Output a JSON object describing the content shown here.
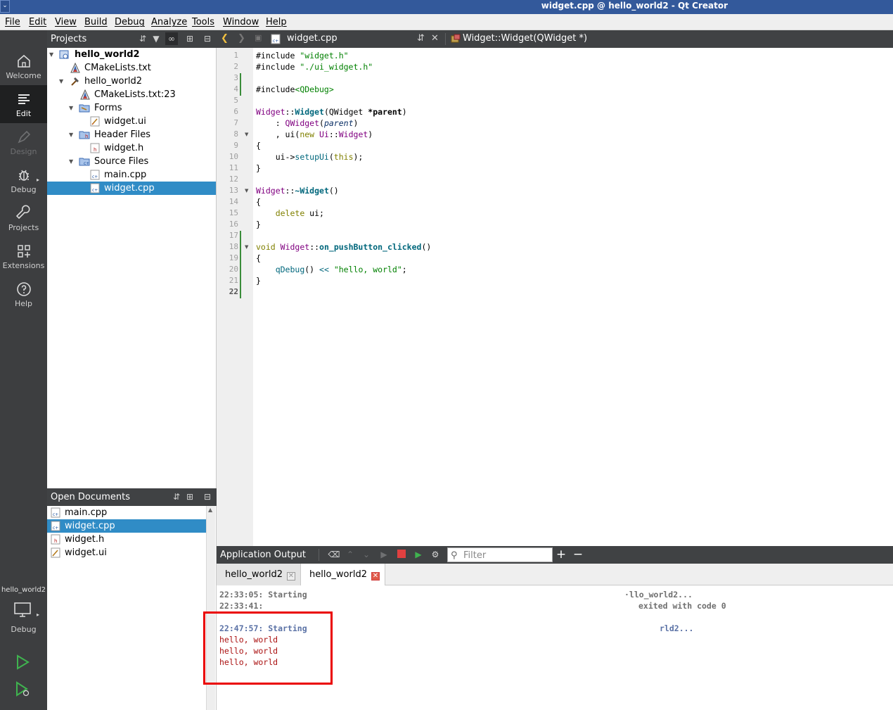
{
  "window": {
    "title": "widget.cpp @ hello_world2 - Qt Creator",
    "system_menu_icon": "chevron-down-icon"
  },
  "menu": [
    "File",
    "Edit",
    "View",
    "Build",
    "Debug",
    "Analyze",
    "Tools",
    "Window",
    "Help"
  ],
  "modes": [
    {
      "label": "Welcome",
      "icon": "home-icon",
      "state": "normal"
    },
    {
      "label": "Edit",
      "icon": "edit-lines-icon",
      "state": "active"
    },
    {
      "label": "Design",
      "icon": "pen-icon",
      "state": "disabled"
    },
    {
      "label": "Debug",
      "icon": "bug-icon",
      "state": "normal"
    },
    {
      "label": "Projects",
      "icon": "wrench-icon",
      "state": "normal"
    },
    {
      "label": "Extensions",
      "icon": "grid-plus-icon",
      "state": "normal"
    },
    {
      "label": "Help",
      "icon": "question-circle-icon",
      "state": "normal"
    }
  ],
  "kit": {
    "project": "hello_world2",
    "build_config": "Debug"
  },
  "projects_pane": {
    "title": "Projects",
    "tree": [
      {
        "label": "hello_world2",
        "icon": "project-icon",
        "expanded": true,
        "bold": true,
        "selected": false
      },
      {
        "label": "CMakeLists.txt",
        "icon": "cmake-icon",
        "selected": false
      },
      {
        "label": "hello_world2",
        "icon": "hammer-icon",
        "expanded": true,
        "selected": false
      },
      {
        "label": "CMakeLists.txt:23",
        "icon": "cmake-icon",
        "selected": false
      },
      {
        "label": "Forms",
        "icon": "folder-forms-icon",
        "expanded": true,
        "selected": false
      },
      {
        "label": "widget.ui",
        "icon": "ui-file-icon",
        "selected": false
      },
      {
        "label": "Header Files",
        "icon": "folder-headers-icon",
        "expanded": true,
        "selected": false
      },
      {
        "label": "widget.h",
        "icon": "header-file-icon",
        "selected": false
      },
      {
        "label": "Source Files",
        "icon": "folder-sources-icon",
        "expanded": true,
        "selected": false
      },
      {
        "label": "main.cpp",
        "icon": "cpp-file-icon",
        "selected": false
      },
      {
        "label": "widget.cpp",
        "icon": "cpp-file-icon",
        "selected": true
      }
    ]
  },
  "open_documents": {
    "title": "Open Documents",
    "items": [
      {
        "label": "main.cpp",
        "icon": "cpp-file-icon",
        "selected": false
      },
      {
        "label": "widget.cpp",
        "icon": "cpp-file-icon",
        "selected": true
      },
      {
        "label": "widget.h",
        "icon": "header-file-icon",
        "selected": false
      },
      {
        "label": "widget.ui",
        "icon": "ui-file-icon",
        "selected": false
      }
    ]
  },
  "editor": {
    "file": "widget.cpp",
    "symbol": "Widget::Widget(QWidget *)",
    "current_line": 22,
    "lines": [
      "#include \"widget.h\"",
      "#include \"./ui_widget.h\"",
      "",
      "#include<QDebug>",
      "",
      "Widget::Widget(QWidget *parent)",
      "    : QWidget(parent)",
      "    , ui(new Ui::Widget)",
      "{",
      "    ui->setupUi(this);",
      "}",
      "",
      "Widget::~Widget()",
      "{",
      "    delete ui;",
      "}",
      "",
      "void Widget::on_pushButton_clicked()",
      "{",
      "    qDebug() << \"hello, world\";",
      "}",
      ""
    ]
  },
  "output": {
    "title": "Application Output",
    "filter_placeholder": "Filter",
    "tabs": [
      {
        "label": "hello_world2",
        "active": false
      },
      {
        "label": "hello_world2",
        "active": true
      }
    ],
    "lines": [
      {
        "left": "22:33:05: Starting",
        "right": "·llo_world2...",
        "style": "info"
      },
      {
        "left": "22:33:41:",
        "right": "exited with code 0",
        "style": "info"
      },
      {
        "left": "",
        "right": "",
        "style": "blank"
      },
      {
        "left": "22:47:57: Starting",
        "right": "rld2...",
        "style": "blue"
      },
      {
        "left": "hello, world",
        "right": "",
        "style": "red"
      },
      {
        "left": "hello, world",
        "right": "",
        "style": "red"
      },
      {
        "left": "hello, world",
        "right": "",
        "style": "red"
      }
    ]
  },
  "colors": {
    "titlebar": "#33599b",
    "modebar": "#3d3e40",
    "pane_header": "#404244",
    "selection": "#308cc6",
    "highlight_box": "#ea0000",
    "app_output_red": "#aa1111"
  }
}
